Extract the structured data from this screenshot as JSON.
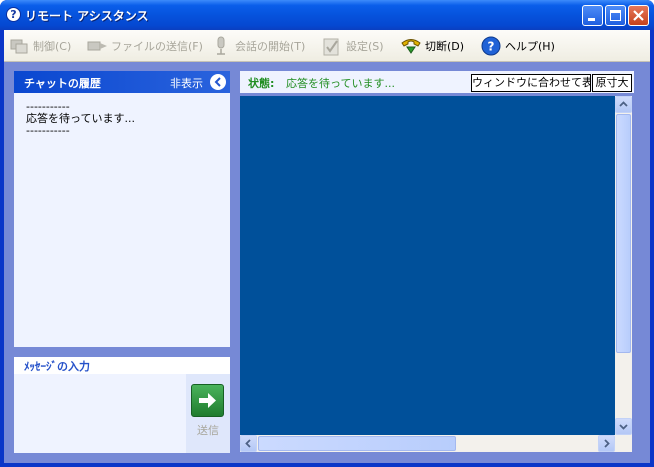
{
  "window": {
    "title": "リモート アシスタンス",
    "title_icon_glyph": "?"
  },
  "toolbar": {
    "items": [
      {
        "label": "制御(C)",
        "icon": "control-icon",
        "enabled": false
      },
      {
        "label": "ファイルの送信(F)",
        "icon": "send-file-icon",
        "enabled": false
      },
      {
        "label": "会話の開始(T)",
        "icon": "microphone-icon",
        "enabled": false
      },
      {
        "label": "設定(S)",
        "icon": "settings-check-icon",
        "enabled": false
      },
      {
        "label": "切断(D)",
        "icon": "disconnect-phone-icon",
        "enabled": true
      },
      {
        "label": "ヘルプ(H)",
        "icon": "help-icon",
        "enabled": true
      }
    ]
  },
  "chat": {
    "title": "チャットの履歴",
    "hide_label": "非表示",
    "log": "-----------\n応答を待っています...\n-----------"
  },
  "message": {
    "title": "ﾒｯｾｰｼﾞの入力",
    "input_value": "",
    "send_label": "送信"
  },
  "status": {
    "label": "状態:",
    "text": "応答を待っています...",
    "fit_button": "ウィンドウに合わせて表示",
    "actual_button": "原寸大"
  },
  "colors": {
    "titlebar": "#0653dd",
    "remote_screen": "#00509a",
    "status_text": "#218e21",
    "panel_header": "#0a47d0"
  }
}
